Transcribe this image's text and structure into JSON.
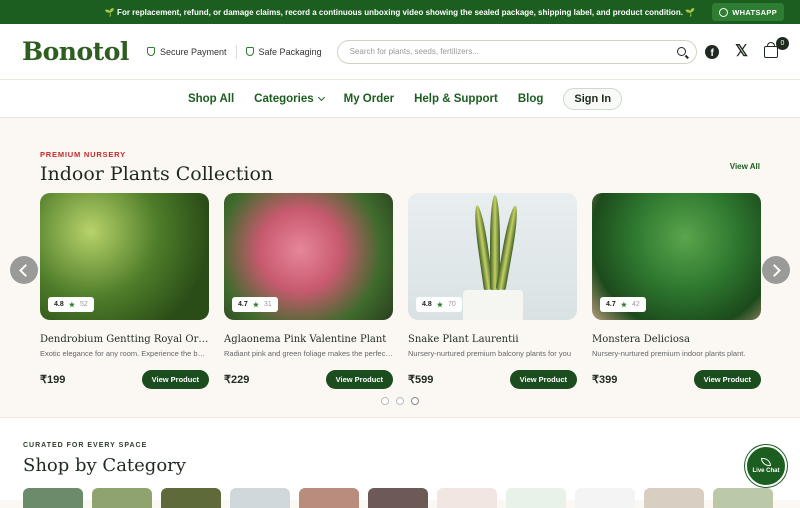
{
  "announcement": {
    "text": "🌱 For replacement, refund, or damage claims, record a continuous unboxing video showing the sealed package, shipping label, and product condition. 🌱",
    "whatsapp_label": "WHATSAPP"
  },
  "header": {
    "logo": "Bonotol",
    "badge_secure": "Secure Payment",
    "badge_packaging": "Safe Packaging",
    "search_placeholder": "Search for plants, seeds, fertilizers...",
    "facebook_glyph": "f",
    "x_glyph": "𝕏",
    "cart_count": "0"
  },
  "nav": {
    "items": [
      {
        "label": "Shop All"
      },
      {
        "label": "Categories"
      },
      {
        "label": "My Order"
      },
      {
        "label": "Help & Support"
      },
      {
        "label": "Blog"
      }
    ],
    "signin": "Sign In"
  },
  "featured": {
    "eyebrow": "PREMIUM NURSERY",
    "title": "Indoor Plants Collection",
    "view_all": "View All",
    "star": "★",
    "button_label": "View Product",
    "products": [
      {
        "name": "Dendrobium Gentting Royal Orchid",
        "desc": "Exotic elegance for any room. Experience the beauty",
        "price": "₹199",
        "rating": "4.8",
        "reviews": "52"
      },
      {
        "name": "Aglaonema Pink Valentine Plant",
        "desc": "Radiant pink and green foliage makes the perfect gift",
        "price": "₹229",
        "rating": "4.7",
        "reviews": "31"
      },
      {
        "name": "Snake Plant Laurentii",
        "desc": "Nursery-nurtured premium balcony plants for you",
        "price": "₹599",
        "rating": "4.8",
        "reviews": "70"
      },
      {
        "name": "Monstera Deliciosa",
        "desc": "Nursery-nurtured premium indoor plants plant.",
        "price": "₹399",
        "rating": "4.7",
        "reviews": "42"
      }
    ]
  },
  "categories": {
    "eyebrow": "CURATED FOR EVERY SPACE",
    "title": "Shop by Category",
    "thumb_colors": [
      "#6a8c6a",
      "#8fa36e",
      "#5f6a3a",
      "#cfd9dc",
      "#b98c7e",
      "#6d5a56",
      "#f1e6e2",
      "#e8f2e8",
      "#f4f4f4",
      "#d8cfc2",
      "#bcc9a8"
    ]
  },
  "chat": {
    "label": "Live Chat"
  },
  "colors": {
    "brand_green": "#1b5e20",
    "accent_red": "#c62828",
    "background": "#fbf8f3"
  }
}
